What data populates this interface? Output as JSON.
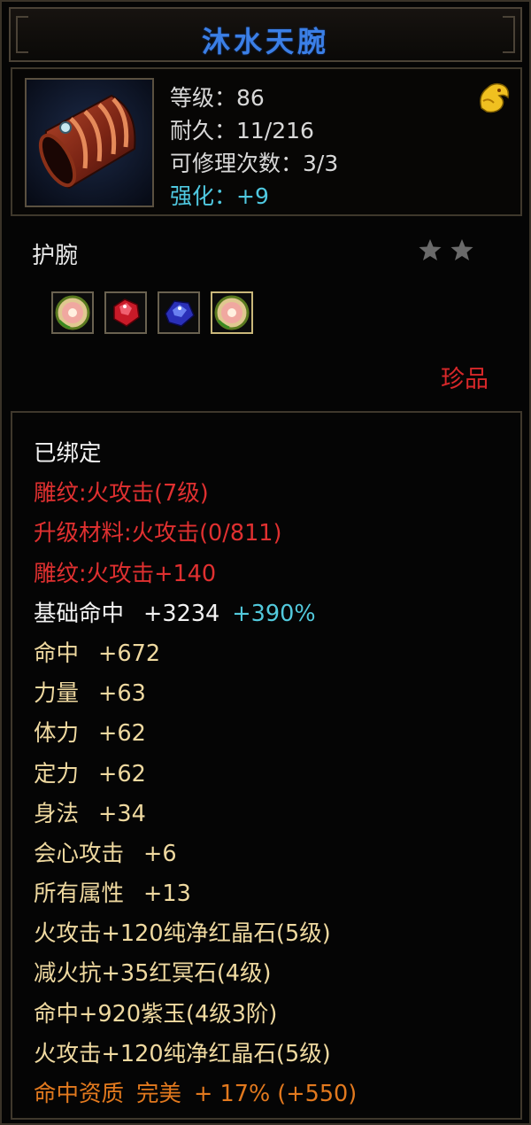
{
  "item": {
    "name": "沐水天腕",
    "level": "等级：86",
    "durability": "耐久：11/216",
    "repairs": "可修理次数：3/3",
    "enhance": "强化：+9",
    "type": "护腕",
    "rarity": "珍品",
    "stars": 2,
    "icon": "bracer-icon",
    "badge_icon": "dragon-badge-icon"
  },
  "gems": [
    {
      "name": "gem-flower-icon",
      "color": "#e8b0a0"
    },
    {
      "name": "gem-ruby-icon",
      "color": "#d02030"
    },
    {
      "name": "gem-sapphire-icon",
      "color": "#3040d0"
    },
    {
      "name": "gem-flower-icon",
      "color": "#e8b0a0"
    }
  ],
  "attributes": {
    "bound": "已绑定",
    "engrave": "雕纹:火攻击(7级)",
    "upgrade_material": "升级材料:火攻击(0/811)",
    "engrave_bonus": "雕纹:火攻击+140",
    "base_hit_label": "基础命中",
    "base_hit_value": "+3234",
    "base_hit_pct": "+390%",
    "stats": [
      {
        "label": "命中",
        "value": "+672"
      },
      {
        "label": "力量",
        "value": "+63"
      },
      {
        "label": "体力",
        "value": "+62"
      },
      {
        "label": "定力",
        "value": "+62"
      },
      {
        "label": "身法",
        "value": "+34"
      },
      {
        "label": "会心攻击",
        "value": "+6"
      },
      {
        "label": "所有属性",
        "value": "+13"
      }
    ],
    "gem_effects": [
      "火攻击+120纯净红晶石(5级)",
      "减火抗+35红冥石(4级)",
      "命中+920紫玉(4级3阶)",
      "火攻击+120纯净红晶石(5级)"
    ],
    "quality_label": "命中资质",
    "quality_grade": "完美",
    "quality_value": "+ 17% (+550)"
  },
  "colors": {
    "title": "#3b7fe6",
    "engrave": "#e03030",
    "stat": "#efd9a0",
    "percent": "#52c9dc",
    "quality": "#e2791e",
    "rarity": "#d8282a"
  }
}
